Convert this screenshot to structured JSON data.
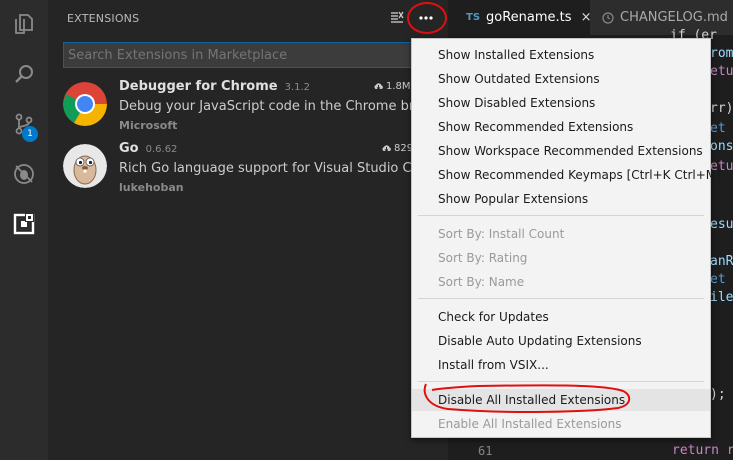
{
  "sidebar": {
    "title": "EXTENSIONS",
    "search_placeholder": "Search Extensions in Marketplace",
    "extensions": [
      {
        "name": "Debugger for Chrome",
        "version": "3.1.2",
        "description": "Debug your JavaScript code in the Chrome browser, or any other target that supports the Chrome Debugger protocol.",
        "publisher": "Microsoft",
        "downloads": "1.8M",
        "icon": "chrome-logo"
      },
      {
        "name": "Go",
        "version": "0.6.62",
        "description": "Rich Go language support for Visual Studio Code",
        "publisher": "lukehoban",
        "downloads": "829",
        "icon": "go-gopher-logo"
      }
    ]
  },
  "activity_bar": {
    "scm_badge": "1",
    "icons": [
      "explorer-icon",
      "search-icon",
      "source-control-icon",
      "debug-icon",
      "extensions-icon"
    ]
  },
  "tabs": [
    {
      "type_badge": "TS",
      "label": "goRename.ts",
      "close": "×",
      "active": true
    },
    {
      "label": "CHANGELOG.md",
      "active": false
    }
  ],
  "editor": {
    "visible_line_number": "61",
    "code_fragments": [
      "if (er",
      "rom",
      "etu",
      "rr)",
      "et",
      "ons",
      "etu",
      "esu",
      "anR",
      "et",
      "ile",
      ");",
      "return r"
    ]
  },
  "menu": {
    "groups": [
      [
        "Show Installed Extensions",
        "Show Outdated Extensions",
        "Show Disabled Extensions",
        "Show Recommended Extensions",
        "Show Workspace Recommended Extensions",
        "Show Recommended Keymaps [Ctrl+K Ctrl+M]",
        "Show Popular Extensions"
      ],
      [
        "Sort By: Install Count",
        "Sort By: Rating",
        "Sort By: Name"
      ],
      [
        "Check for Updates",
        "Disable Auto Updating Extensions",
        "Install from VSIX..."
      ],
      [
        "Disable All Installed Extensions",
        "Enable All Installed Extensions"
      ]
    ]
  },
  "colors": {
    "accent": "#007acc",
    "annotation": "#e01010",
    "ts_badge": "#519aba"
  }
}
